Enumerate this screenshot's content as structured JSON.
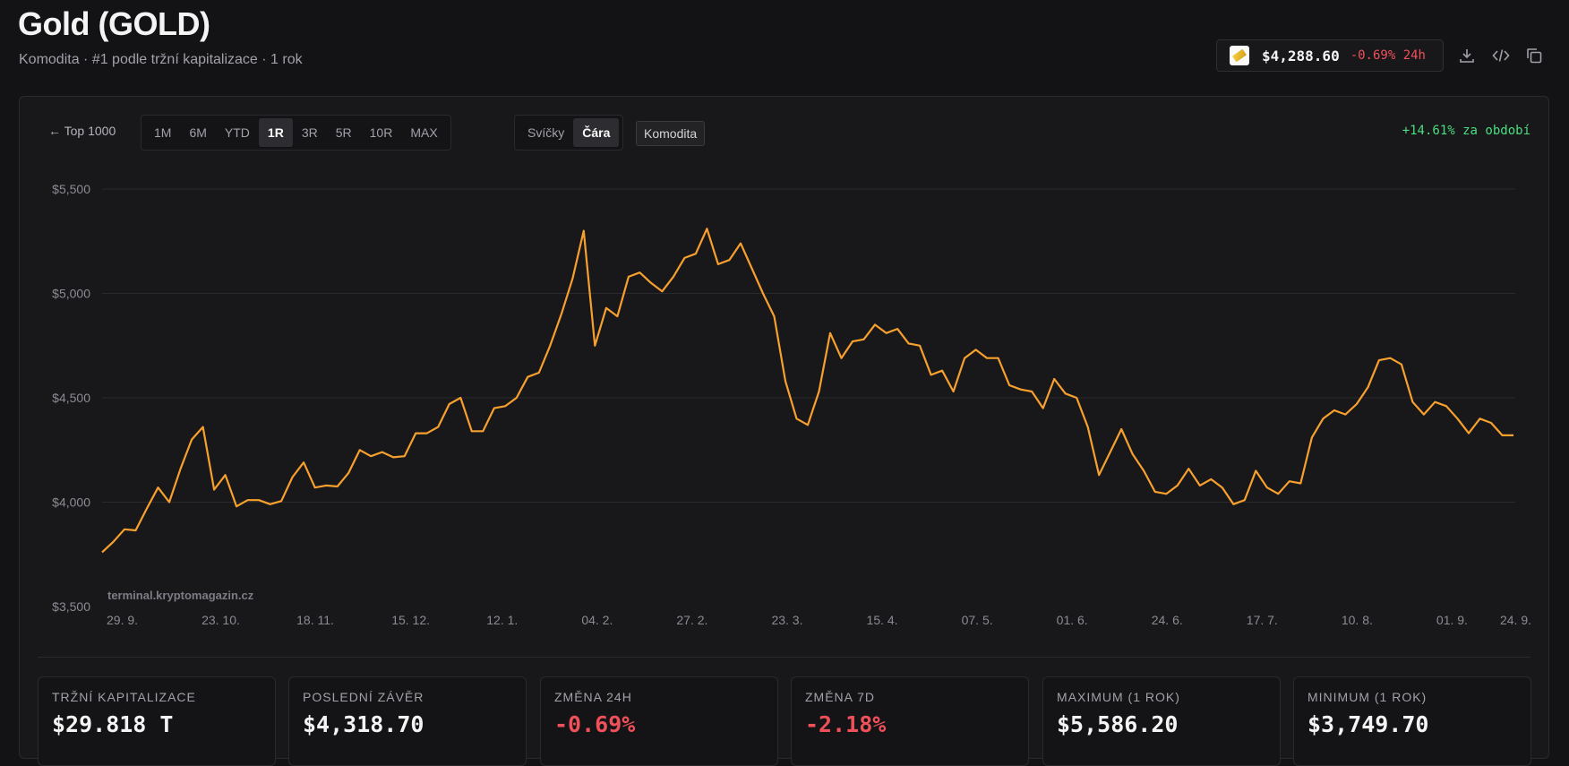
{
  "header": {
    "title": "Gold (GOLD)",
    "subtitle": "Komodita · #1 podle tržní kapitalizace · 1 rok"
  },
  "ticker": {
    "price": "$4,288.60",
    "change": "-0.69% 24h"
  },
  "toolbar": {
    "icons": [
      "download-icon",
      "code-icon",
      "copy-icon"
    ]
  },
  "controls": {
    "back": "← Top 1000",
    "ranges": [
      "1M",
      "6M",
      "YTD",
      "1R",
      "3R",
      "5R",
      "10R",
      "MAX"
    ],
    "active_range": "1R",
    "chart_types": [
      "Svíčky",
      "Čára"
    ],
    "active_chart_type": "Čára",
    "tag": "Komodita",
    "performance": "+14.61% za období"
  },
  "colors": {
    "line": "#f7a02e",
    "positive": "#4ade80",
    "negative": "#f0505a",
    "background": "#18181b"
  },
  "chart_data": {
    "type": "line",
    "watermark": "terminal.kryptomagazin.cz",
    "ylim": [
      3500,
      5500
    ],
    "y_ticks": [
      {
        "value": 5500,
        "label": "$5,500"
      },
      {
        "value": 5000,
        "label": "$5,000"
      },
      {
        "value": 4500,
        "label": "$4,500"
      },
      {
        "value": 4000,
        "label": "$4,000"
      },
      {
        "value": 3500,
        "label": "$3,500"
      }
    ],
    "x_ticks": [
      "29. 9.",
      "23. 10.",
      "18. 11.",
      "15. 12.",
      "12. 1.",
      "04. 2.",
      "27. 2.",
      "23. 3.",
      "15. 4.",
      "07. 5.",
      "01. 6.",
      "24. 6.",
      "17. 7.",
      "10. 8.",
      "01. 9.",
      "24. 9."
    ],
    "grid": true,
    "series": [
      {
        "values": [
          3760,
          3810,
          3870,
          3865,
          3970,
          4070,
          4000,
          4160,
          4300,
          4360,
          4060,
          4130,
          3980,
          4010,
          4010,
          3990,
          4005,
          4120,
          4190,
          4070,
          4080,
          4075,
          4140,
          4250,
          4220,
          4240,
          4215,
          4220,
          4330,
          4330,
          4360,
          4470,
          4500,
          4340,
          4340,
          4450,
          4460,
          4500,
          4600,
          4620,
          4750,
          4900,
          5070,
          5300,
          4750,
          4930,
          4890,
          5080,
          5100,
          5050,
          5010,
          5080,
          5170,
          5190,
          5310,
          5140,
          5160,
          5240,
          5120,
          5000,
          4890,
          4580,
          4400,
          4370,
          4530,
          4810,
          4690,
          4770,
          4780,
          4850,
          4810,
          4830,
          4760,
          4750,
          4610,
          4630,
          4530,
          4690,
          4730,
          4690,
          4690,
          4560,
          4540,
          4530,
          4450,
          4590,
          4520,
          4500,
          4360,
          4130,
          4240,
          4350,
          4230,
          4150,
          4050,
          4040,
          4080,
          4160,
          4080,
          4110,
          4070,
          3990,
          4010,
          4150,
          4070,
          4040,
          4100,
          4090,
          4310,
          4400,
          4440,
          4420,
          4470,
          4550,
          4680,
          4690,
          4660,
          4480,
          4420,
          4480,
          4460,
          4400,
          4330,
          4400,
          4380,
          4320,
          4320
        ]
      }
    ]
  },
  "stats": [
    {
      "label": "TRŽNÍ KAPITALIZACE",
      "value": "$29.818 T",
      "negative": false
    },
    {
      "label": "POSLEDNÍ ZÁVĚR",
      "value": "$4,318.70",
      "negative": false
    },
    {
      "label": "ZMĚNA 24H",
      "value": "-0.69%",
      "negative": true
    },
    {
      "label": "ZMĚNA 7D",
      "value": "-2.18%",
      "negative": true
    },
    {
      "label": "MAXIMUM (1 ROK)",
      "value": "$5,586.20",
      "negative": false
    },
    {
      "label": "MINIMUM (1 ROK)",
      "value": "$3,749.70",
      "negative": false
    }
  ]
}
